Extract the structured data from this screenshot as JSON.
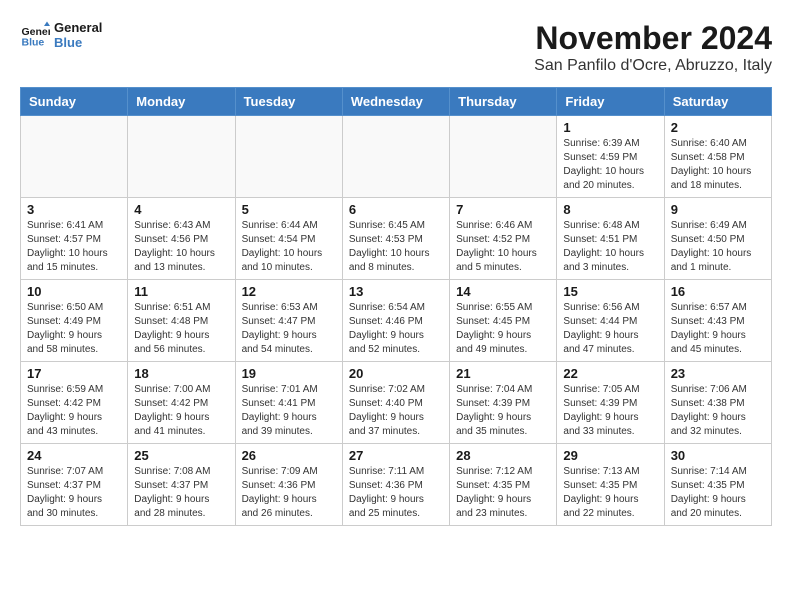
{
  "logo": {
    "general": "General",
    "blue": "Blue"
  },
  "header": {
    "month": "November 2024",
    "location": "San Panfilo d'Ocre, Abruzzo, Italy"
  },
  "weekdays": [
    "Sunday",
    "Monday",
    "Tuesday",
    "Wednesday",
    "Thursday",
    "Friday",
    "Saturday"
  ],
  "weeks": [
    [
      {
        "day": "",
        "info": ""
      },
      {
        "day": "",
        "info": ""
      },
      {
        "day": "",
        "info": ""
      },
      {
        "day": "",
        "info": ""
      },
      {
        "day": "",
        "info": ""
      },
      {
        "day": "1",
        "info": "Sunrise: 6:39 AM\nSunset: 4:59 PM\nDaylight: 10 hours and 20 minutes."
      },
      {
        "day": "2",
        "info": "Sunrise: 6:40 AM\nSunset: 4:58 PM\nDaylight: 10 hours and 18 minutes."
      }
    ],
    [
      {
        "day": "3",
        "info": "Sunrise: 6:41 AM\nSunset: 4:57 PM\nDaylight: 10 hours and 15 minutes."
      },
      {
        "day": "4",
        "info": "Sunrise: 6:43 AM\nSunset: 4:56 PM\nDaylight: 10 hours and 13 minutes."
      },
      {
        "day": "5",
        "info": "Sunrise: 6:44 AM\nSunset: 4:54 PM\nDaylight: 10 hours and 10 minutes."
      },
      {
        "day": "6",
        "info": "Sunrise: 6:45 AM\nSunset: 4:53 PM\nDaylight: 10 hours and 8 minutes."
      },
      {
        "day": "7",
        "info": "Sunrise: 6:46 AM\nSunset: 4:52 PM\nDaylight: 10 hours and 5 minutes."
      },
      {
        "day": "8",
        "info": "Sunrise: 6:48 AM\nSunset: 4:51 PM\nDaylight: 10 hours and 3 minutes."
      },
      {
        "day": "9",
        "info": "Sunrise: 6:49 AM\nSunset: 4:50 PM\nDaylight: 10 hours and 1 minute."
      }
    ],
    [
      {
        "day": "10",
        "info": "Sunrise: 6:50 AM\nSunset: 4:49 PM\nDaylight: 9 hours and 58 minutes."
      },
      {
        "day": "11",
        "info": "Sunrise: 6:51 AM\nSunset: 4:48 PM\nDaylight: 9 hours and 56 minutes."
      },
      {
        "day": "12",
        "info": "Sunrise: 6:53 AM\nSunset: 4:47 PM\nDaylight: 9 hours and 54 minutes."
      },
      {
        "day": "13",
        "info": "Sunrise: 6:54 AM\nSunset: 4:46 PM\nDaylight: 9 hours and 52 minutes."
      },
      {
        "day": "14",
        "info": "Sunrise: 6:55 AM\nSunset: 4:45 PM\nDaylight: 9 hours and 49 minutes."
      },
      {
        "day": "15",
        "info": "Sunrise: 6:56 AM\nSunset: 4:44 PM\nDaylight: 9 hours and 47 minutes."
      },
      {
        "day": "16",
        "info": "Sunrise: 6:57 AM\nSunset: 4:43 PM\nDaylight: 9 hours and 45 minutes."
      }
    ],
    [
      {
        "day": "17",
        "info": "Sunrise: 6:59 AM\nSunset: 4:42 PM\nDaylight: 9 hours and 43 minutes."
      },
      {
        "day": "18",
        "info": "Sunrise: 7:00 AM\nSunset: 4:42 PM\nDaylight: 9 hours and 41 minutes."
      },
      {
        "day": "19",
        "info": "Sunrise: 7:01 AM\nSunset: 4:41 PM\nDaylight: 9 hours and 39 minutes."
      },
      {
        "day": "20",
        "info": "Sunrise: 7:02 AM\nSunset: 4:40 PM\nDaylight: 9 hours and 37 minutes."
      },
      {
        "day": "21",
        "info": "Sunrise: 7:04 AM\nSunset: 4:39 PM\nDaylight: 9 hours and 35 minutes."
      },
      {
        "day": "22",
        "info": "Sunrise: 7:05 AM\nSunset: 4:39 PM\nDaylight: 9 hours and 33 minutes."
      },
      {
        "day": "23",
        "info": "Sunrise: 7:06 AM\nSunset: 4:38 PM\nDaylight: 9 hours and 32 minutes."
      }
    ],
    [
      {
        "day": "24",
        "info": "Sunrise: 7:07 AM\nSunset: 4:37 PM\nDaylight: 9 hours and 30 minutes."
      },
      {
        "day": "25",
        "info": "Sunrise: 7:08 AM\nSunset: 4:37 PM\nDaylight: 9 hours and 28 minutes."
      },
      {
        "day": "26",
        "info": "Sunrise: 7:09 AM\nSunset: 4:36 PM\nDaylight: 9 hours and 26 minutes."
      },
      {
        "day": "27",
        "info": "Sunrise: 7:11 AM\nSunset: 4:36 PM\nDaylight: 9 hours and 25 minutes."
      },
      {
        "day": "28",
        "info": "Sunrise: 7:12 AM\nSunset: 4:35 PM\nDaylight: 9 hours and 23 minutes."
      },
      {
        "day": "29",
        "info": "Sunrise: 7:13 AM\nSunset: 4:35 PM\nDaylight: 9 hours and 22 minutes."
      },
      {
        "day": "30",
        "info": "Sunrise: 7:14 AM\nSunset: 4:35 PM\nDaylight: 9 hours and 20 minutes."
      }
    ]
  ]
}
